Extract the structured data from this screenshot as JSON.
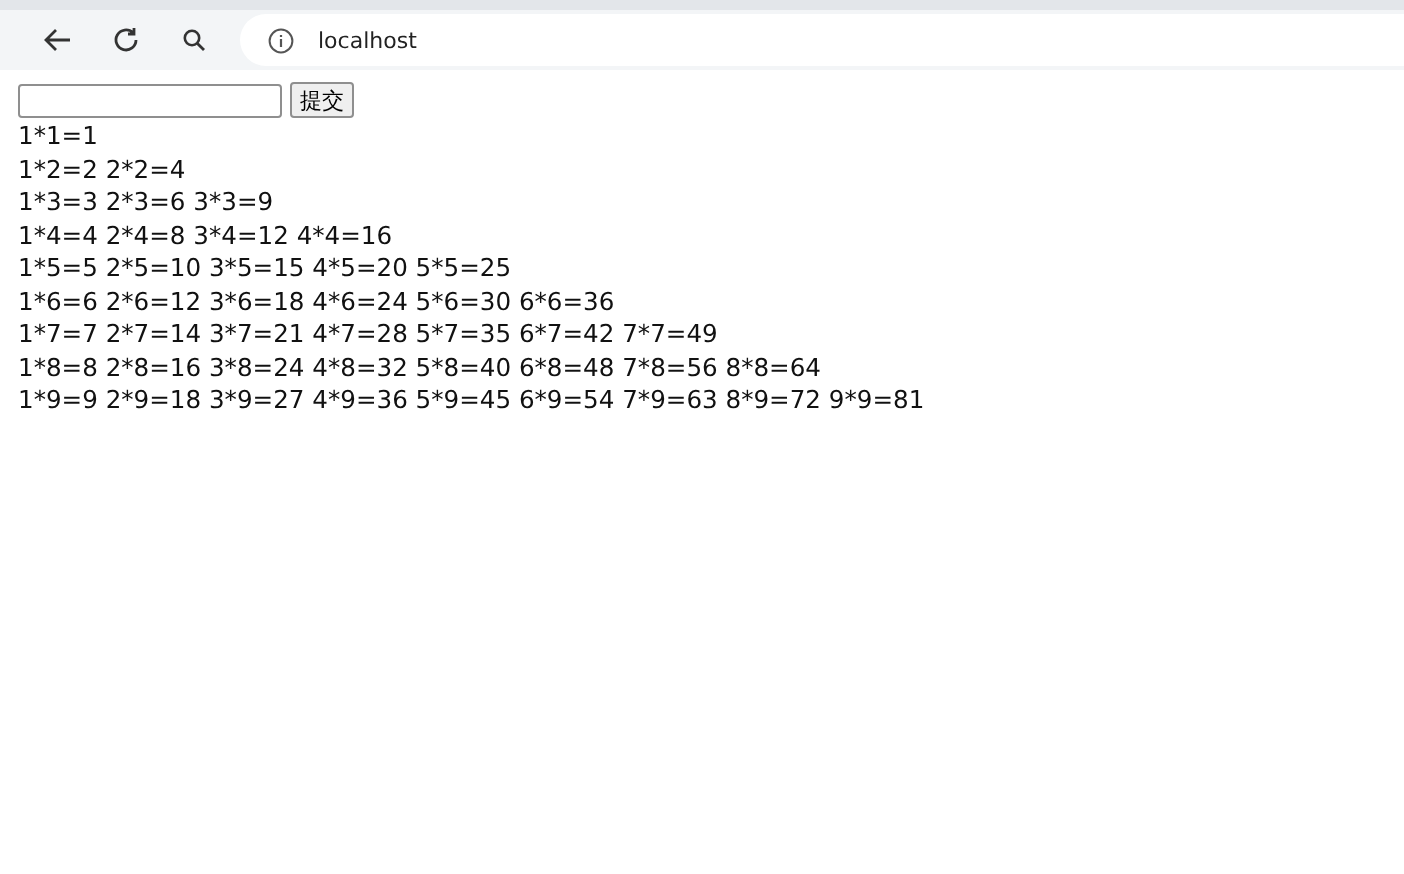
{
  "browser": {
    "address": "localhost"
  },
  "form": {
    "button": "提交"
  },
  "lines": [
    "1*1=1",
    "1*2=2 2*2=4",
    "1*3=3 2*3=6 3*3=9",
    "1*4=4 2*4=8 3*4=12 4*4=16",
    "1*5=5 2*5=10 3*5=15 4*5=20 5*5=25",
    "1*6=6 2*6=12 3*6=18 4*6=24 5*6=30 6*6=36",
    "1*7=7 2*7=14 3*7=21 4*7=28 5*7=35 6*7=42 7*7=49",
    "1*8=8 2*8=16 3*8=24 4*8=32 5*8=40 6*8=48 7*8=56 8*8=64",
    "1*9=9 2*9=18 3*9=27 4*9=36 5*9=45 6*9=54 7*9=63 8*9=72 9*9=81"
  ]
}
